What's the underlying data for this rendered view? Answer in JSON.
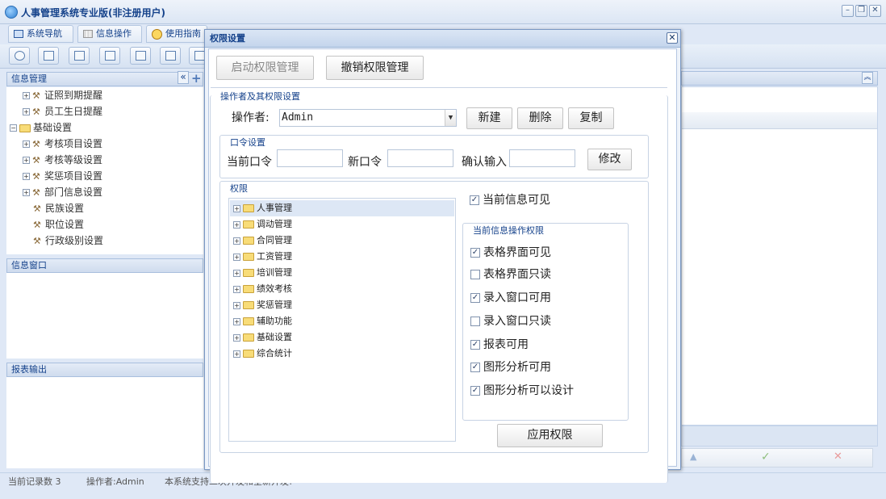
{
  "app": {
    "title": "人事管理系统专业版(非注册用户)",
    "window_buttons": {
      "minimize": "–",
      "restore": "❐",
      "close": "✕"
    }
  },
  "nav": {
    "tabs": [
      {
        "label": "系统导航",
        "icon": "monitor-icon"
      },
      {
        "label": "信息操作",
        "icon": "grid-icon"
      },
      {
        "label": "使用指南",
        "icon": "clock-icon"
      }
    ]
  },
  "left": {
    "info_panel_title": "信息管理",
    "collapse_glyph": "«",
    "add_glyph": "+",
    "tree": [
      {
        "label": "证照到期提醒",
        "type": "leaf-expandable"
      },
      {
        "label": "员工生日提醒",
        "type": "leaf-expandable"
      },
      {
        "label": "基础设置",
        "type": "folder"
      },
      {
        "label": "考核项目设置",
        "type": "leaf-expandable"
      },
      {
        "label": "考核等级设置",
        "type": "leaf-expandable"
      },
      {
        "label": "奖惩项目设置",
        "type": "leaf-expandable"
      },
      {
        "label": "部门信息设置",
        "type": "leaf-expandable"
      },
      {
        "label": "民族设置",
        "type": "leaf"
      },
      {
        "label": "职位设置",
        "type": "leaf"
      },
      {
        "label": "行政级别设置",
        "type": "leaf"
      }
    ],
    "info_window_title": "信息窗口",
    "report_title": "报表输出"
  },
  "status": {
    "record_count": "当前记录数 3",
    "operator": "操作者:Admin",
    "message": "本系统支持二次开发和全新开发!"
  },
  "right_footer": {
    "up_glyph": "▲",
    "ok_glyph": "✓",
    "cancel_glyph": "✕",
    "expand_glyph": "︽"
  },
  "dialog": {
    "title": "权限设置",
    "close_glyph": "✕",
    "enable_btn": "启动权限管理",
    "revoke_btn": "撤销权限管理",
    "operator_section": {
      "legend": "操作者及其权限设置",
      "operator_label": "操作者:",
      "operator_value": "Admin",
      "new_btn": "新建",
      "delete_btn": "删除",
      "copy_btn": "复制"
    },
    "password_section": {
      "legend": "口令设置",
      "current_label": "当前口令",
      "new_label": "新口令",
      "confirm_label": "确认输入",
      "modify_btn": "修改"
    },
    "permissions": {
      "legend": "权限",
      "tree": [
        "人事管理",
        "调动管理",
        "合同管理",
        "工资管理",
        "培训管理",
        "绩效考核",
        "奖惩管理",
        "辅助功能",
        "基础设置",
        "综合统计"
      ],
      "selected_index": 0,
      "visible_label": "当前信息可见",
      "visible_checked": true,
      "ops_legend": "当前信息操作权限",
      "ops": [
        {
          "label": "表格界面可见",
          "checked": true
        },
        {
          "label": "表格界面只读",
          "checked": false
        },
        {
          "label": "录入窗口可用",
          "checked": true
        },
        {
          "label": "录入窗口只读",
          "checked": false
        },
        {
          "label": "报表可用",
          "checked": true
        },
        {
          "label": "图形分析可用",
          "checked": true
        },
        {
          "label": "图形分析可以设计",
          "checked": true
        }
      ],
      "apply_btn": "应用权限"
    }
  }
}
